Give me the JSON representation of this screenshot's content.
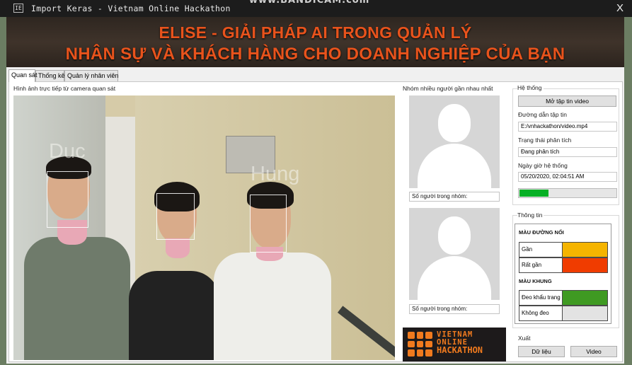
{
  "window": {
    "app_icon": "IE",
    "title": "Import Keras - Vietnam Online Hackathon",
    "watermark": "www.BANDICAM.com",
    "close": "X"
  },
  "banner": {
    "line1": "ELISE - GIẢI PHÁP AI TRONG QUẢN LÝ",
    "line2": "NHÂN SỰ VÀ KHÁCH HÀNG CHO DOANH NGHIỆP CỦA BẠN",
    "color": "#e8531c"
  },
  "tabs": [
    {
      "label": "Quan sát",
      "active": true
    },
    {
      "label": "Thống kê",
      "active": false
    },
    {
      "label": "Quản lý nhân viên",
      "active": false
    }
  ],
  "camera": {
    "title": "Hình ảnh trực tiếp từ camera quan sát",
    "faces": [
      "Duc",
      "Hung"
    ]
  },
  "groups": {
    "title": "Nhóm nhiều người gần nhau nhất",
    "count_label_1": "Số người trong nhóm:",
    "count_label_2": "Số người trong nhóm:"
  },
  "logo": {
    "line1": "VIETNAM",
    "line2": "ONLINE",
    "line3": "HACKATHON"
  },
  "system": {
    "title": "Hệ thống",
    "open_button": "Mở tập tin video",
    "path_label": "Đường dẫn tập tin",
    "path_value": "E:/vnhackathon/video.mp4",
    "status_label": "Trạng thái phân tích",
    "status_value": "Đang phân tích",
    "datetime_label": "Ngày giờ hệ thống",
    "datetime_value": "05/20/2020, 02:04:51 AM",
    "progress": 0.3
  },
  "info": {
    "title": "Thông tin",
    "line_section": "MÀU ĐƯỜNG NỐI",
    "near_label": "Gần",
    "near_color": "#f5b400",
    "very_near_label": "Rất gần",
    "very_near_color": "#f03c00",
    "frame_section": "MÀU KHUNG",
    "mask_label": "Đeo khẩu trang",
    "mask_color": "#3f9a22",
    "no_mask_label": "Không đeo",
    "no_mask_color": "#e3e3e3"
  },
  "export": {
    "title": "Xuất",
    "data_button": "Dữ liệu",
    "video_button": "Video"
  }
}
